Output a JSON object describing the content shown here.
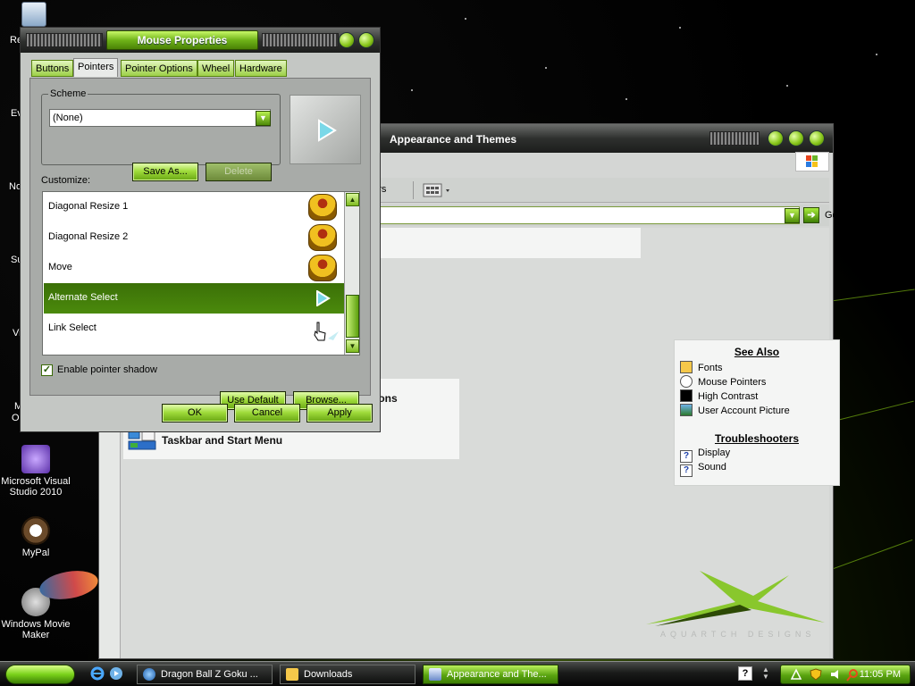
{
  "desktop": {
    "icon_fragments": [
      "Re",
      "Ev",
      "No",
      "Su",
      "Vi",
      "M",
      "O"
    ],
    "icons": [
      {
        "name": "visual-studio",
        "lines": [
          "Microsoft Visual",
          "Studio 2010"
        ]
      },
      {
        "name": "mypal",
        "lines": [
          "MyPal"
        ]
      },
      {
        "name": "windows-movie-maker",
        "lines": [
          "Windows Movie",
          "Maker"
        ]
      }
    ]
  },
  "explorer": {
    "title": "Appearance and Themes",
    "toolbar_fragment": "ders",
    "address_go": "Go",
    "task_fragment": "tions",
    "task_taskbar": "Taskbar and Start Menu",
    "see_also": {
      "title": "See Also",
      "links": [
        "Fonts",
        "Mouse Pointers",
        "High Contrast",
        "User Account Picture"
      ]
    },
    "troubleshooters": {
      "title": "Troubleshooters",
      "links": [
        "Display",
        "Sound"
      ]
    },
    "logo_text": "AQUARTCH DESIGNS"
  },
  "dialog": {
    "title": "Mouse Properties",
    "tabs": [
      "Buttons",
      "Pointers",
      "Pointer Options",
      "Wheel",
      "Hardware"
    ],
    "active_tab": "Pointers",
    "scheme_label": "Scheme",
    "scheme_value": "(None)",
    "save_as": "Save As...",
    "delete": "Delete",
    "customize_label": "Customize:",
    "pointer_list": [
      {
        "label": "Diagonal Resize 1",
        "cursor": "goku"
      },
      {
        "label": "Diagonal Resize 2",
        "cursor": "goku"
      },
      {
        "label": "Move",
        "cursor": "goku"
      },
      {
        "label": "Alternate Select",
        "cursor": "arrow",
        "selected": true
      },
      {
        "label": "Link Select",
        "cursor": "hand"
      }
    ],
    "enable_shadow_label": "Enable pointer shadow",
    "enable_shadow_checked": true,
    "use_default": "Use Default",
    "browse": "Browse...",
    "ok": "OK",
    "cancel": "Cancel",
    "apply": "Apply"
  },
  "taskbar": {
    "buttons": [
      {
        "label": "Dragon Ball Z Goku ...",
        "active": false
      },
      {
        "label": "Downloads",
        "active": false
      },
      {
        "label": "Appearance and The...",
        "active": true
      }
    ],
    "clock": "11:05 PM"
  },
  "colors": {
    "accent_green": "#6fb318",
    "selection_green": "#3b7008",
    "titlebar_dark": "#2e302e"
  }
}
